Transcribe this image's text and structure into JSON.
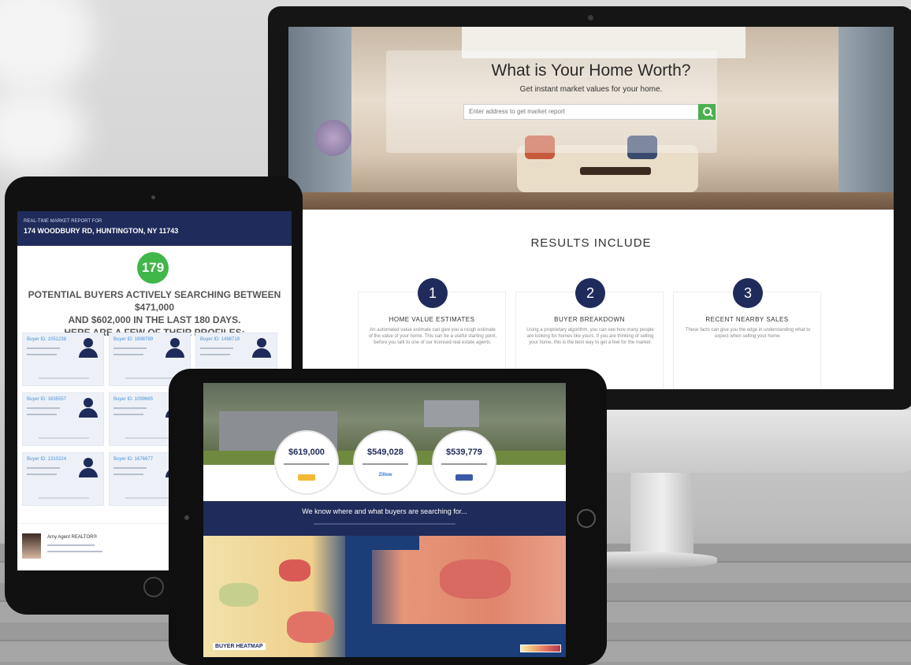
{
  "monitor": {
    "hero_title": "What is Your Home Worth?",
    "hero_subtitle": "Get instant market values for your home.",
    "search_placeholder": "Enter address to get market report",
    "results_title": "RESULTS INCLUDE",
    "cards": [
      {
        "number": "1",
        "title": "HOME VALUE ESTIMATES",
        "body": "An automated value estimate can give you a rough estimate of the value of your home. This can be a useful starting point, before you talk to one of our licensed real estate agents."
      },
      {
        "number": "2",
        "title": "BUYER BREAKDOWN",
        "body": "Using a proprietary algorithm, you can see how many people are looking for homes like yours. If you are thinking of selling your home, this is the best way to get a feel for the market."
      },
      {
        "number": "3",
        "title": "RECENT NEARBY SALES",
        "body": "These facts can give you the edge in understanding what to expect when selling your home."
      }
    ]
  },
  "tablet_left": {
    "kicker": "REAL-TIME MARKET REPORT FOR",
    "address": "174 WOODBURY RD, HUNTINGTON, NY 11743",
    "buyer_count": "179",
    "message_line1": "POTENTIAL BUYERS ACTIVELY SEARCHING BETWEEN $471,000",
    "message_line2": "AND $602,000 IN THE LAST 180 DAYS.",
    "message_line3": "HERE ARE A FEW OF THEIR PROFILES:",
    "buyers": [
      {
        "id": "Buyer ID: 1051238"
      },
      {
        "id": "Buyer ID: 1698789"
      },
      {
        "id": "Buyer ID: 1498718"
      },
      {
        "id": "Buyer ID: 1635557"
      },
      {
        "id": "Buyer ID: 1099665"
      },
      {
        "id": "Buyer ID: 1310224"
      },
      {
        "id": "Buyer ID: 1676677"
      }
    ],
    "agent_name": "Amy Agent REALTOR®"
  },
  "tablet_right": {
    "values": [
      {
        "amount": "$619,000"
      },
      {
        "amount": "$549,028",
        "provider": "Zillow"
      },
      {
        "amount": "$539,779"
      }
    ],
    "banner": "We know where and what buyers are searching for...",
    "map_label": "BUYER HEATMAP"
  },
  "colors": {
    "navy": "#1f2b5a",
    "green": "#41b649",
    "search_green": "#4caf50"
  }
}
